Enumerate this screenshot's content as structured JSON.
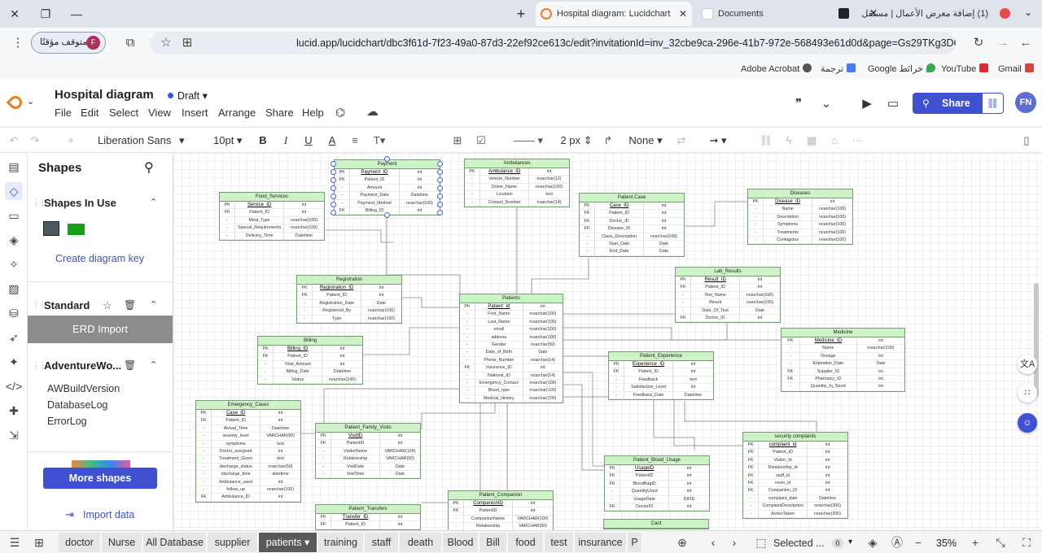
{
  "browser": {
    "tabs": [
      {
        "title": "Hospital diagram: Lucidchart",
        "active": true
      },
      {
        "title": "Documents",
        "active": false
      },
      {
        "title": "(1) إضافة معرض الأعمال | مستقل",
        "active": false
      }
    ],
    "paused_label": "متوقف مؤقتًا",
    "profile_initial": "F",
    "url": "lucid.app/lucidchart/dbc3f61d-7f23-49a0-87d3-22ef92ce613c/edit?invitationId=inv_32cbe9ca-296e-41b7-972e-568493e61d0d&page=Gs29TKg3DGqD#",
    "bookmarks": [
      "Adobe Acrobat",
      "ترجمة",
      "Google خرائط",
      "YouTube",
      "Gmail"
    ]
  },
  "app": {
    "doc_title": "Hospital diagram",
    "status": "Draft",
    "menu": [
      "File",
      "Edit",
      "Select",
      "View",
      "Insert",
      "Arrange",
      "Share",
      "Help"
    ],
    "share_label": "Share",
    "user_initials": "FN"
  },
  "toolbar": {
    "font": "Liberation Sans",
    "font_size": "10pt",
    "line_width": "2 px",
    "line_end": "None"
  },
  "shapes_panel": {
    "title": "Shapes",
    "in_use_title": "Shapes In Use",
    "create_key": "Create diagram key",
    "standard_title": "Standard",
    "erd_import": "ERD Import",
    "adventure_title": "AdventureWo...",
    "adventure_items": [
      "AWBuildVersion",
      "DatabaseLog",
      "ErrorLog"
    ],
    "more_shapes": "More shapes",
    "import_data": "Import data"
  },
  "entities": [
    {
      "id": "payment",
      "title": "Payment",
      "rows": [
        [
          "PK",
          "Payment_ID",
          "int"
        ],
        [
          "FK",
          "Patient_ID",
          "int"
        ],
        [
          "-",
          "Amount",
          "int"
        ],
        [
          "-",
          "Payment_Date",
          "Datetime"
        ],
        [
          "-",
          "Payment_Method",
          "nvarchar(100)"
        ],
        [
          "FK",
          "Billing_ID",
          "int"
        ]
      ]
    },
    {
      "id": "ambulances",
      "title": "Ambulances",
      "rows": [
        [
          "PK",
          "Ambulance_ID",
          "int"
        ],
        [
          "-",
          "Vehicle_Number",
          "nvarchar(12)"
        ],
        [
          "-",
          "Driver_Name",
          "nvarchar(100)"
        ],
        [
          "-",
          "Location",
          "text"
        ],
        [
          "-",
          "Contact_Number",
          "nvarchar(14)"
        ]
      ]
    },
    {
      "id": "food_services",
      "title": "Food_Services",
      "rows": [
        [
          "PK",
          "Service_ID",
          "int"
        ],
        [
          "FK",
          "Patient_ID",
          "int"
        ],
        [
          "-",
          "Meal_Type",
          "nvarchar(100)"
        ],
        [
          "-",
          "Special_Requirements",
          "nvarchar(100)"
        ],
        [
          "-",
          "Delivery_Time",
          "Datetime"
        ]
      ]
    },
    {
      "id": "patient_case",
      "title": "Patient Case",
      "rows": [
        [
          "PK",
          "Case_ID",
          "int"
        ],
        [
          "FK",
          "Patient_ID",
          "int"
        ],
        [
          "FK",
          "Doctor_ID",
          "int"
        ],
        [
          "FK",
          "Disease_ID",
          "int"
        ],
        [
          "-",
          "Class_Description",
          "nvarchar(100)"
        ],
        [
          "-",
          "Start_Date",
          "Date"
        ],
        [
          "-",
          "End_Date",
          "Date"
        ]
      ]
    },
    {
      "id": "diseases",
      "title": "Diseases",
      "rows": [
        [
          "PK",
          "Disease_ID",
          "int"
        ],
        [
          "-",
          "Name",
          "nvarchar(100)"
        ],
        [
          "-",
          "Description",
          "nvarchar(100)"
        ],
        [
          "-",
          "Symptoms",
          "nvarchar(100)"
        ],
        [
          "-",
          "Treatments",
          "nvarchar(100)"
        ],
        [
          "-",
          "Contagious",
          "nvarchar(100)"
        ]
      ]
    },
    {
      "id": "registration",
      "title": "Registration",
      "rows": [
        [
          "PK",
          "Registration_ID",
          "int"
        ],
        [
          "FK",
          "Patient_ID",
          "int"
        ],
        [
          "-",
          "Registration_Date",
          "Date"
        ],
        [
          "-",
          "Registered_By",
          "nvarchar(100)"
        ],
        [
          "-",
          "Type",
          "nvarchar(100)"
        ]
      ]
    },
    {
      "id": "lab_results",
      "title": "Lab_Results",
      "rows": [
        [
          "PK",
          "Result_ID",
          "int"
        ],
        [
          "FK",
          "Patient_ID",
          "int"
        ],
        [
          "-",
          "Test_Name",
          "nvarchar(100)"
        ],
        [
          "-",
          "Result",
          "nvarchar(100)"
        ],
        [
          "-",
          "Date_Of_Test",
          "Date"
        ],
        [
          "FK",
          "Doctor_ID",
          "int"
        ]
      ]
    },
    {
      "id": "patients",
      "title": "Patients",
      "rows": [
        [
          "PK",
          "Patient_Id",
          "int"
        ],
        [
          "-",
          "First_Name",
          "nvarchar(100)"
        ],
        [
          "-",
          "Last_Name",
          "nvarchar(100)"
        ],
        [
          "-",
          "email",
          "nvarchar(100)"
        ],
        [
          "-",
          "address",
          "nvarchar(100)"
        ],
        [
          "-",
          "Gender",
          "nvarchar(50)"
        ],
        [
          "-",
          "Date_of_Birth",
          "Date"
        ],
        [
          "-",
          "Phone_Number",
          "nvarchar(14)"
        ],
        [
          "FK",
          "Insurance_ID",
          "int"
        ],
        [
          "-",
          "National_ID",
          "nvarchar(14)"
        ],
        [
          "-",
          "Emergency_Contact",
          "nvarchar(100)"
        ],
        [
          "-",
          "Blood_type",
          "nvarchar(100)"
        ],
        [
          "-",
          "Medical_History",
          "nvarchar(100)"
        ]
      ]
    },
    {
      "id": "billing",
      "title": "Billing",
      "rows": [
        [
          "PK",
          "Billing_ID",
          "int"
        ],
        [
          "FK",
          "Patient_ID",
          "int"
        ],
        [
          "-",
          "Total_Amount",
          "int"
        ],
        [
          "-",
          "Billing_Date",
          "Datetime"
        ],
        [
          "-",
          "Status",
          "nvarchar(100)"
        ]
      ]
    },
    {
      "id": "medicine",
      "title": "Medicine",
      "rows": [
        [
          "PK",
          "Medicine_ID",
          "int"
        ],
        [
          "-",
          "Name",
          "nvarchar(100)"
        ],
        [
          "-",
          "Dosage",
          "int"
        ],
        [
          "-",
          "Expiration_Date",
          "Date"
        ],
        [
          "FK",
          "Supplier_ID",
          "int"
        ],
        [
          "FK",
          "Pharmacy_ID",
          "int"
        ],
        [
          "-",
          "Quantity_In_Stock",
          "int"
        ]
      ]
    },
    {
      "id": "patient_experience",
      "title": "Patient_Experience",
      "rows": [
        [
          "PK",
          "Experience_ID",
          "int"
        ],
        [
          "FK",
          "Patient_ID",
          "int"
        ],
        [
          "-",
          "Feedback",
          "text"
        ],
        [
          "-",
          "Satisfaction_Level",
          "int"
        ],
        [
          "-",
          "Feedback_Date",
          "Datetime"
        ]
      ]
    },
    {
      "id": "emergency_cases",
      "title": "Emergency_Cases",
      "rows": [
        [
          "PK",
          "Case_ID",
          "int"
        ],
        [
          "FK",
          "Patient_ID",
          "int"
        ],
        [
          "-",
          "Arrival_Time",
          "Datetime"
        ],
        [
          "-",
          "severity_level",
          "VARCHAR(50)"
        ],
        [
          "-",
          "symptoms",
          "text"
        ],
        [
          "-",
          "Doctor_assigned",
          "int"
        ],
        [
          "-",
          "Treatment_Given",
          "text"
        ],
        [
          "-",
          "discharge_status",
          "nvarchar(50)"
        ],
        [
          "-",
          "discharge_time",
          "datetime"
        ],
        [
          "-",
          "Ambulance_used",
          "int"
        ],
        [
          "-",
          "follow_up",
          "nvarchar(100)"
        ],
        [
          "FK",
          "Ambulance_ID",
          "int"
        ]
      ]
    },
    {
      "id": "patient_family_visits",
      "title": "Patient_Family_Visits",
      "rows": [
        [
          "PK",
          "VisitID",
          "int"
        ],
        [
          "FK",
          "PatientID",
          "int"
        ],
        [
          "-",
          "VisitorName",
          "VARCHAR(100)"
        ],
        [
          "-",
          "Relationship",
          "VARCHAR(50)"
        ],
        [
          "-",
          "VisitDate",
          "Date"
        ],
        [
          "-",
          "VisitTime",
          "Date"
        ]
      ]
    },
    {
      "id": "security_complaints",
      "title": "security complaints",
      "rows": [
        [
          "PK",
          "complaint_id",
          "int"
        ],
        [
          "FK",
          "Patient_ID",
          "int"
        ],
        [
          "FK",
          "Visitor_Id",
          "int"
        ],
        [
          "FK",
          "Relationship_id",
          "int"
        ],
        [
          "FK",
          "staff_id",
          "int"
        ],
        [
          "FK",
          "room_id",
          "int"
        ],
        [
          "FK",
          "Companion_ID",
          "int"
        ],
        [
          "-",
          "complaint_date",
          "Datetime"
        ],
        [
          "-",
          "ComplaintDescription",
          "nvarchar(300)"
        ],
        [
          "-",
          "ActionTaken",
          "nvarchar(300)"
        ]
      ]
    },
    {
      "id": "patient_blood_usage",
      "title": "Patient_Blood_Usage",
      "rows": [
        [
          "PK",
          "UsageID",
          "int"
        ],
        [
          "FK",
          "PatientID",
          "int"
        ],
        [
          "FK",
          "BloodBagID",
          "int"
        ],
        [
          "-",
          "QuantityUsed",
          "int"
        ],
        [
          "-",
          "UsageDate",
          "DATE"
        ],
        [
          "FK",
          "DoctorID",
          "int"
        ]
      ]
    },
    {
      "id": "patient_companion",
      "title": "Patient_Companion",
      "rows": [
        [
          "PK",
          "CompanionID",
          "int"
        ],
        [
          "FK",
          "PatientID",
          "int"
        ],
        [
          "-",
          "CompanionName",
          "VARCHAR(100)"
        ],
        [
          "-",
          "Relationship",
          "VARCHAR(50)"
        ]
      ]
    },
    {
      "id": "patient_transfers",
      "title": "Patient_Transfers",
      "rows": [
        [
          "PK",
          "Transfer_ID",
          "int"
        ],
        [
          "FK",
          "Patient_ID",
          "int"
        ]
      ]
    },
    {
      "id": "card",
      "title": "Card",
      "rows": []
    }
  ],
  "zoom": "35%",
  "selected_label": "Selected ...",
  "selected_count": "0",
  "pages": [
    "doctor",
    "Nurse",
    "All Database",
    "supplier",
    "patients",
    "training",
    "staff",
    "death",
    "Blood",
    "Bill",
    "food",
    "test",
    "insurance",
    "P"
  ],
  "active_page": "patients",
  "colors": {
    "accent": "#3f51d0",
    "entity_header": "#ccf2c6",
    "entity_border": "#7a9a7a"
  }
}
